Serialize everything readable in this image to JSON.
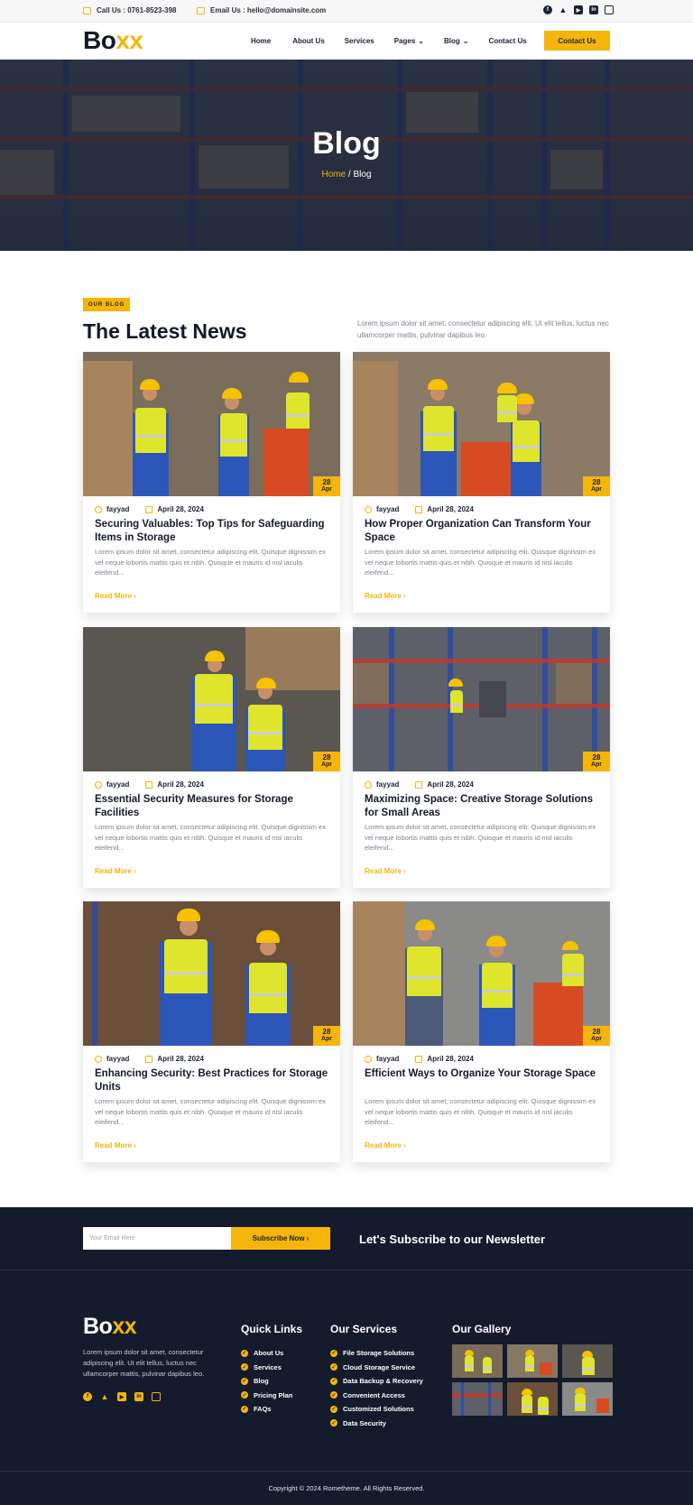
{
  "topbar": {
    "phone": "Call Us : 0761-8523-398",
    "email": "Email Us : hello@domainsite.com",
    "social": [
      "facebook-icon",
      "twitter-icon",
      "youtube-icon",
      "linkedin-icon",
      "instagram-icon"
    ]
  },
  "nav": {
    "logo_main": "Bo",
    "logo_accent": "xx",
    "items": [
      {
        "label": "Home",
        "dropdown": false
      },
      {
        "label": "About Us",
        "dropdown": false
      },
      {
        "label": "Services",
        "dropdown": false
      },
      {
        "label": "Pages",
        "dropdown": true
      },
      {
        "label": "Blog",
        "dropdown": true
      },
      {
        "label": "Contact Us",
        "dropdown": false
      }
    ],
    "cta": "Contact Us"
  },
  "hero": {
    "title": "Blog",
    "crumb_home": "Home",
    "crumb_sep": " / ",
    "crumb_current": "Blog"
  },
  "section": {
    "badge": "OUR BLOG",
    "title": "The Latest News",
    "description": "Lorem ipsum dolor sit amet, consectetur adipiscing elit. Ut elit tellus, luctus nec ullamcorper mattis, pulvinar dapibus leo."
  },
  "posts": [
    {
      "author": "fayyad",
      "date": "April 28, 2024",
      "day": "28",
      "month": "Apr",
      "title": "Securing Valuables: Top Tips for Safeguarding Items in Storage",
      "excerpt": "Lorem ipsum dolor sit amet, consectetur adipiscing elit. Quisque dignissim ex vel neque lobortis mattis quis et nibh. Quisque et mauris id nisl iaculis eleifend...",
      "read_more": "Read More"
    },
    {
      "author": "fayyad",
      "date": "April 28, 2024",
      "day": "28",
      "month": "Apr",
      "title": "How Proper Organization Can Transform Your Space",
      "excerpt": "Lorem ipsum dolor sit amet, consectetur adipiscing elit. Quisque dignissim ex vel neque lobortis mattis quis et nibh. Quisque et mauris id nisl iaculis eleifend...",
      "read_more": "Read More"
    },
    {
      "author": "fayyad",
      "date": "April 28, 2024",
      "day": "28",
      "month": "Apr",
      "title": "Essential Security Measures for Storage Facilities",
      "excerpt": "Lorem ipsum dolor sit amet, consectetur adipiscing elit. Quisque dignissim ex vel neque lobortis mattis quis et nibh. Quisque et mauris id nisl iaculis eleifend...",
      "read_more": "Read More"
    },
    {
      "author": "fayyad",
      "date": "April 28, 2024",
      "day": "28",
      "month": "Apr",
      "title": "Maximizing Space: Creative Storage Solutions for Small Areas",
      "excerpt": "Lorem ipsum dolor sit amet, consectetur adipiscing elit. Quisque dignissim ex vel neque lobortis mattis quis et nibh. Quisque et mauris id nisl iaculis eleifend...",
      "read_more": "Read More"
    },
    {
      "author": "fayyad",
      "date": "April 28, 2024",
      "day": "28",
      "month": "Apr",
      "title": "Enhancing Security: Best Practices for Storage Units",
      "excerpt": "Lorem ipsum dolor sit amet, consectetur adipiscing elit. Quisque dignissim ex vel neque lobortis mattis quis et nibh. Quisque et mauris id nisl iaculis eleifend...",
      "read_more": "Read More"
    },
    {
      "author": "fayyad",
      "date": "April 28, 2024",
      "day": "28",
      "month": "Apr",
      "title": "Efficient Ways to Organize Your Storage Space",
      "excerpt": "Lorem ipsum dolor sit amet, consectetur adipiscing elit. Quisque dignissim ex vel neque lobortis mattis quis et nibh. Quisque et mauris id nisl iaculis eleifend...",
      "read_more": "Read More"
    }
  ],
  "newsletter": {
    "placeholder": "Your Email Here",
    "button": "Subscribe Now",
    "title": "Let's Subscribe to our Newsletter"
  },
  "footer": {
    "logo_main": "Bo",
    "logo_accent": "xx",
    "description": "Lorem ipsum dolor sit amet, consectetur adipiscing elit. Ut elit tellus, luctus nec ullamcorper mattis, pulvinar dapibus leo.",
    "quick_links_title": "Quick Links",
    "quick_links": [
      "About Us",
      "Services",
      "Blog",
      "Pricing Plan",
      "FAQs"
    ],
    "services_title": "Our Services",
    "services": [
      "File Storage Solutions",
      "Cloud Storage Service",
      "Data Backup & Recovery",
      "Convenient Access",
      "Customized Solutions",
      "Data Security"
    ],
    "gallery_title": "Our Gallery",
    "copyright": "Copyright © 2024 Rometheme. All Rights Reserved."
  },
  "colors": {
    "accent": "#f5b50a",
    "dark": "#141b2c"
  }
}
